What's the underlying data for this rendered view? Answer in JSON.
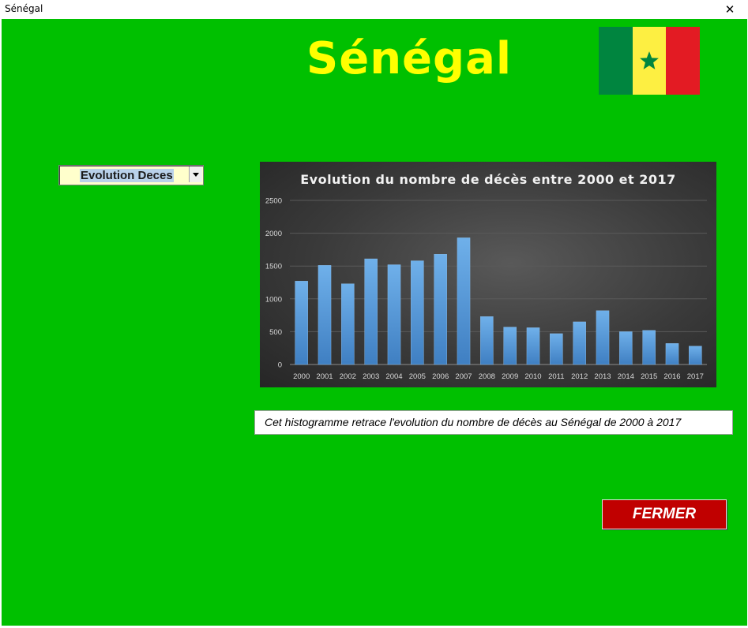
{
  "window": {
    "title": "Sénégal",
    "close_glyph": "✕"
  },
  "heading": "Sénégal",
  "flag": {
    "colors": [
      "#00853f",
      "#fdef42",
      "#e31b23"
    ],
    "star_color": "#00853f",
    "icon": "senegal-flag-icon"
  },
  "selector": {
    "value": "Evolution Deces",
    "icon": "dropdown-arrow-icon"
  },
  "chart_data": {
    "type": "bar",
    "title": "Evolution du nombre de décès entre 2000 et 2017",
    "categories": [
      "2000",
      "2001",
      "2002",
      "2003",
      "2004",
      "2005",
      "2006",
      "2007",
      "2008",
      "2009",
      "2010",
      "2011",
      "2012",
      "2013",
      "2014",
      "2015",
      "2016",
      "2017"
    ],
    "values": [
      1270,
      1510,
      1230,
      1610,
      1520,
      1580,
      1680,
      1930,
      730,
      570,
      560,
      470,
      650,
      820,
      500,
      520,
      320,
      280
    ],
    "yticks": [
      "0",
      "500",
      "1000",
      "1500",
      "2000",
      "2500"
    ],
    "ylim": [
      0,
      2500
    ],
    "grid": true,
    "bar_color": "#5b9bd5",
    "xlabel": "",
    "ylabel": ""
  },
  "caption": "Cet histogramme retrace l'evolution du nombre de décès au Sénégal de 2000 à 2017",
  "close_button": {
    "label": "FERMER",
    "color": "#c00000"
  },
  "form_background": "#00c000"
}
